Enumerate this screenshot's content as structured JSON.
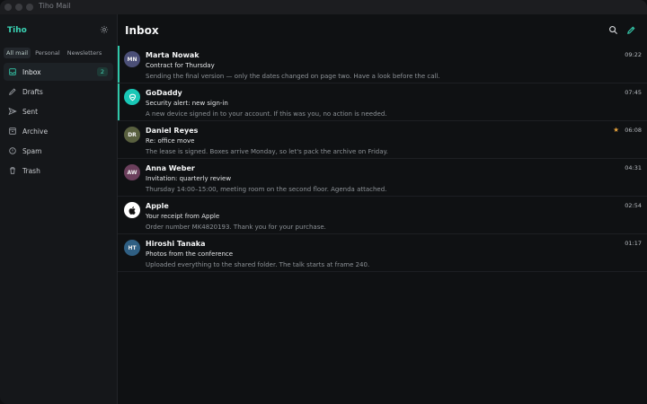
{
  "window": {
    "title": "Tiho Mail"
  },
  "sidebar": {
    "brand": "Tiho",
    "tabs": [
      {
        "label": "All mail",
        "active": true
      },
      {
        "label": "Personal",
        "active": false
      },
      {
        "label": "Newsletters",
        "active": false
      }
    ],
    "items": [
      {
        "label": "Inbox",
        "icon": "inbox-icon",
        "badge": "2",
        "active": true
      },
      {
        "label": "Drafts",
        "icon": "pencil-icon",
        "badge": "",
        "active": false
      },
      {
        "label": "Sent",
        "icon": "send-icon",
        "badge": "",
        "active": false
      },
      {
        "label": "Archive",
        "icon": "archive-icon",
        "badge": "",
        "active": false
      },
      {
        "label": "Spam",
        "icon": "alert-icon",
        "badge": "",
        "active": false
      },
      {
        "label": "Trash",
        "icon": "trash-icon",
        "badge": "",
        "active": false
      }
    ]
  },
  "main": {
    "title": "Inbox",
    "messages": [
      {
        "initials": "MN",
        "avatar_color": "#4b4f77",
        "sender": "Marta Nowak",
        "time": "09:22",
        "subject": "Contract for Thursday",
        "preview": "Sending the final version — only the dates changed on page two. Have a look before the call.",
        "unread": true,
        "starred": false
      },
      {
        "initials": "",
        "avatar_color": "#19c7b6",
        "avatar_icon": "godaddy-logo-icon",
        "sender": "GoDaddy",
        "time": "07:45",
        "subject": "Security alert: new sign-in",
        "preview": "A new device signed in to your account. If this was you, no action is needed.",
        "unread": true,
        "starred": false
      },
      {
        "initials": "DR",
        "avatar_color": "#59603f",
        "sender": "Daniel Reyes",
        "time": "06:08",
        "subject": "Re: office move",
        "preview": "The lease is signed. Boxes arrive Monday, so let's pack the archive on Friday.",
        "unread": false,
        "starred": true
      },
      {
        "initials": "AW",
        "avatar_color": "#6b3f5c",
        "sender": "Anna Weber",
        "time": "04:31",
        "subject": "Invitation: quarterly review",
        "preview": "Thursday 14:00–15:00, meeting room on the second floor. Agenda attached.",
        "unread": false,
        "starred": false
      },
      {
        "initials": "",
        "avatar_color": "#ffffff",
        "avatar_icon": "apple-logo-icon",
        "sender": "Apple",
        "time": "02:54",
        "subject": "Your receipt from Apple",
        "preview": "Order number MK4820193. Thank you for your purchase.",
        "unread": false,
        "starred": false
      },
      {
        "initials": "HT",
        "avatar_color": "#2f5f83",
        "sender": "Hiroshi Tanaka",
        "time": "01:17",
        "subject": "Photos from the conference",
        "preview": "Uploaded everything to the shared folder. The talk starts at frame 240.",
        "unread": false,
        "starred": false
      }
    ]
  },
  "colors": {
    "accent": "#2fc7a9",
    "star": "#e6a23c"
  }
}
